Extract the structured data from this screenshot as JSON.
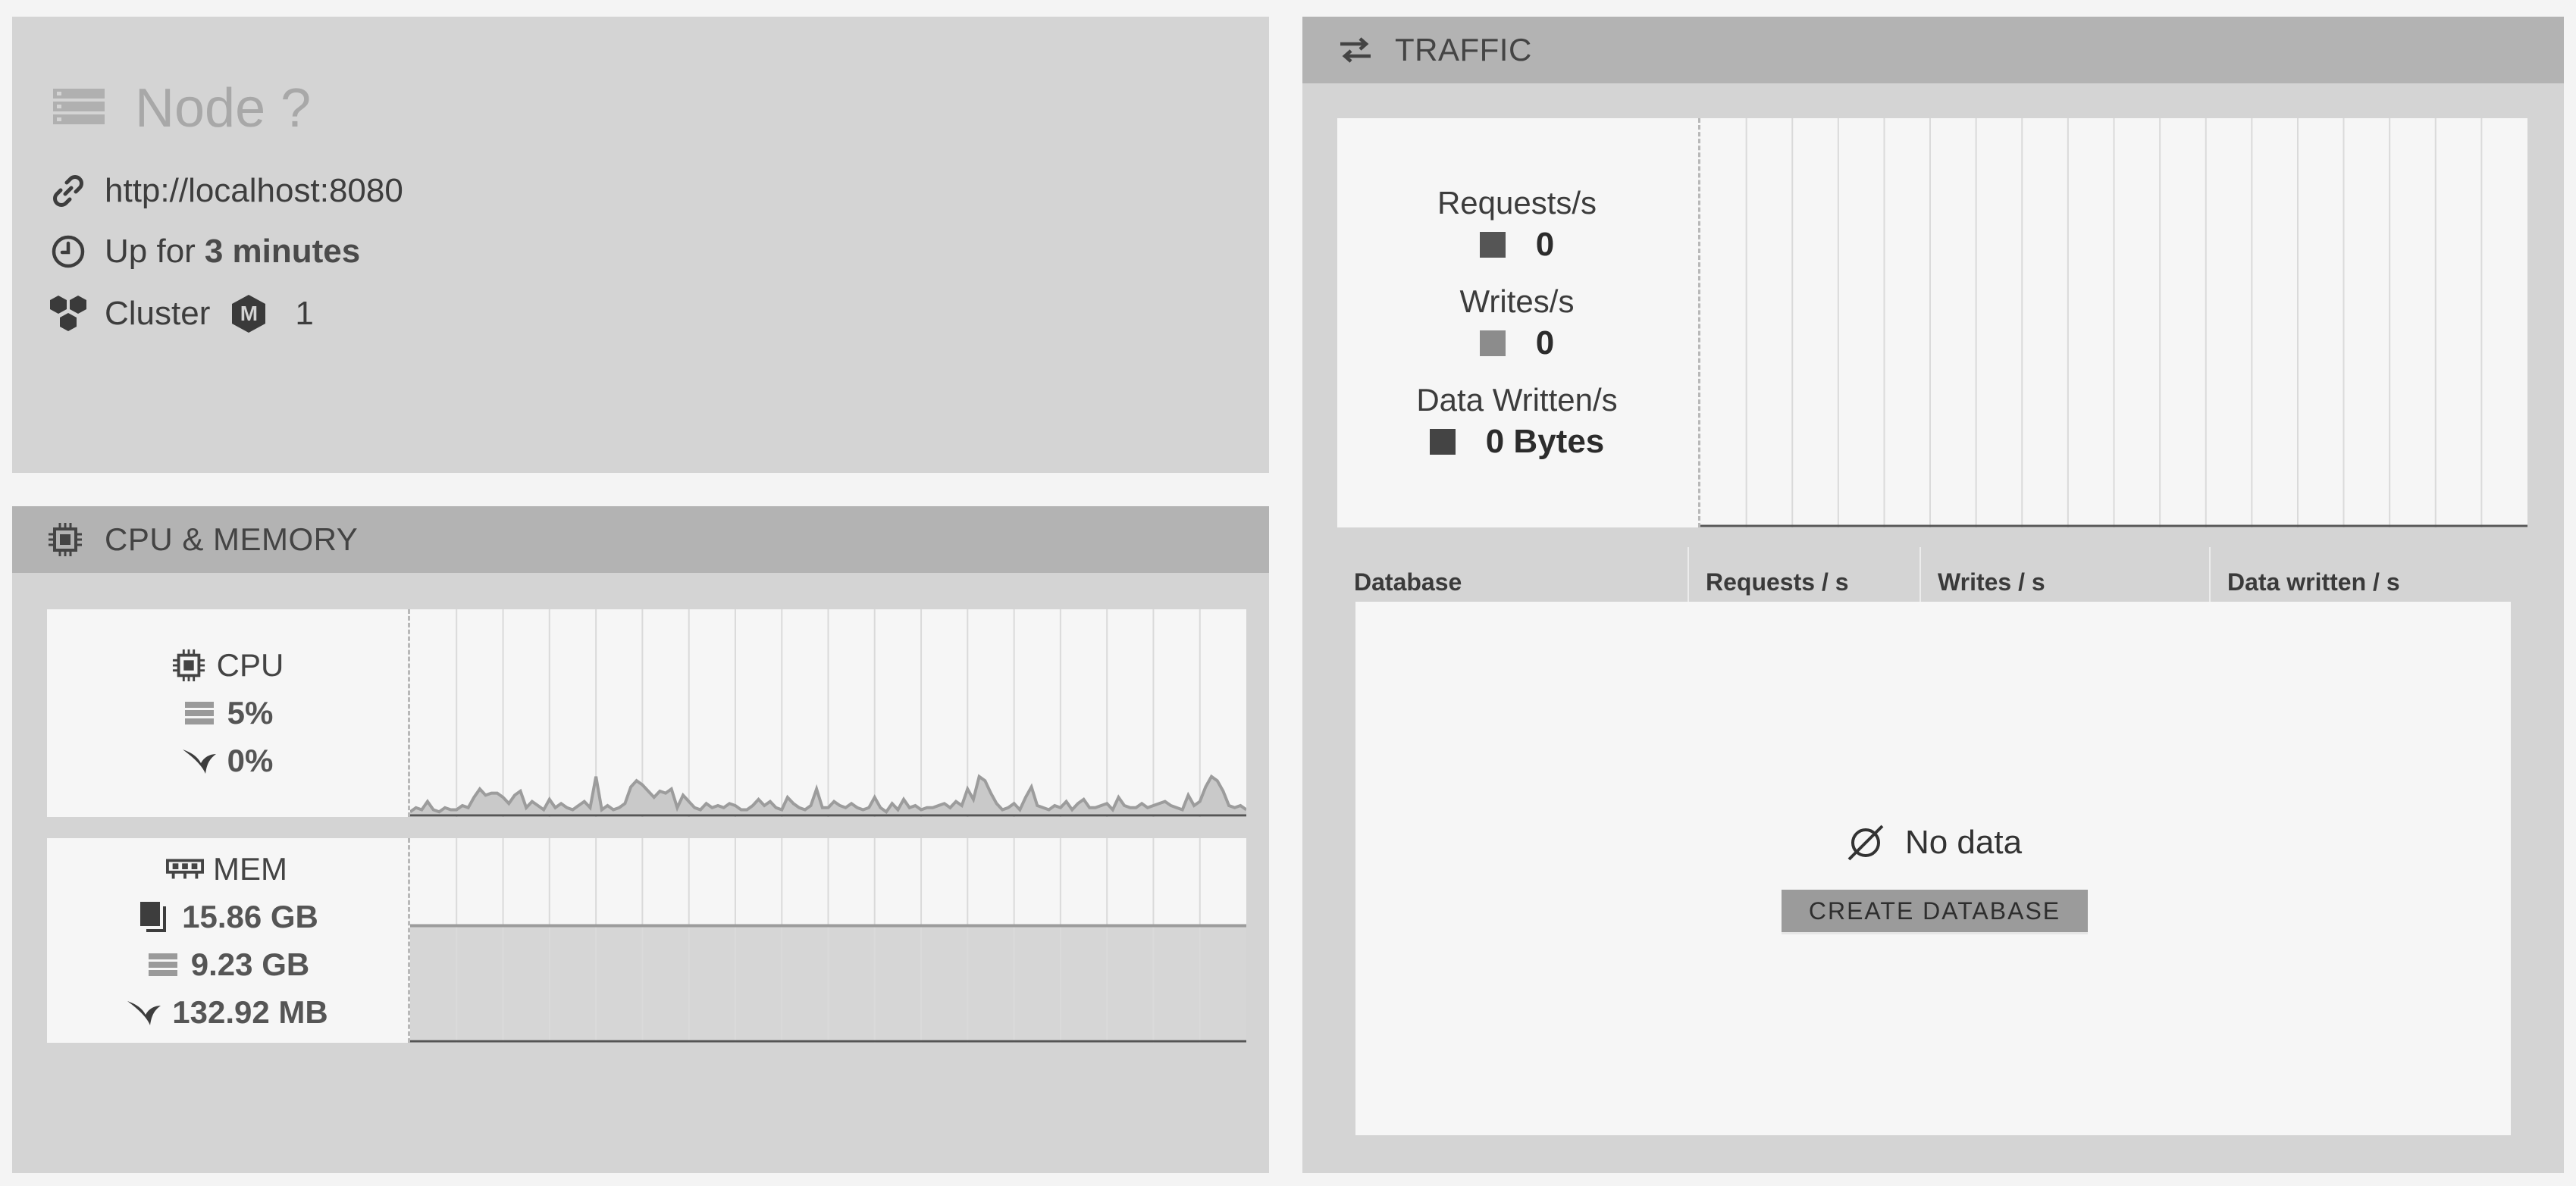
{
  "node": {
    "title": "Node ?",
    "url": "http://localhost:8080",
    "uptime_prefix": "Up for",
    "uptime_value": "3 minutes",
    "cluster_label": "Cluster",
    "cluster_badge": "M",
    "cluster_count": "1"
  },
  "cpu_memory": {
    "title": "CPU & MEMORY",
    "cpu": {
      "label": "CPU",
      "machine_value": "5%",
      "process_value": "0%"
    },
    "mem": {
      "label": "MEM",
      "total": "15.86 GB",
      "machine_used": "9.23 GB",
      "process_used": "132.92 MB"
    },
    "cpu_samples": [
      1,
      3,
      2,
      6,
      2,
      1,
      3,
      2,
      2,
      4,
      3,
      8,
      12,
      9,
      10,
      10,
      8,
      5,
      9,
      11,
      3,
      6,
      4,
      2,
      7,
      3,
      5,
      3,
      2,
      4,
      6,
      3,
      18,
      2,
      4,
      2,
      3,
      5,
      13,
      16,
      14,
      11,
      8,
      11,
      10,
      12,
      3,
      9,
      6,
      3,
      2,
      5,
      3,
      4,
      3,
      5,
      4,
      2,
      2,
      4,
      7,
      4,
      6,
      3,
      2,
      8,
      5,
      3,
      2,
      4,
      12,
      3,
      3,
      6,
      4,
      3,
      5,
      3,
      2,
      3,
      8,
      3,
      1,
      5,
      2,
      7,
      3,
      4,
      2,
      3,
      3,
      4,
      5,
      3,
      6,
      4,
      12,
      7,
      18,
      16,
      10,
      5,
      2,
      3,
      5,
      2,
      8,
      13,
      4,
      3,
      2,
      4,
      3,
      6,
      2,
      5,
      7,
      3,
      3,
      4,
      5,
      2,
      8,
      4,
      3,
      3,
      5,
      3,
      4,
      5,
      6,
      4,
      3,
      2,
      9,
      4,
      6,
      13,
      18,
      16,
      11,
      4,
      3,
      4,
      2
    ],
    "mem_level_percent": 57.2
  },
  "traffic": {
    "title": "TRAFFIC",
    "requests_label": "Requests/s",
    "requests_value": "0",
    "writes_label": "Writes/s",
    "writes_value": "0",
    "data_written_label": "Data Written/s",
    "data_written_value": "0 Bytes",
    "colors": {
      "requests": "#555555",
      "writes": "#8c8c8c",
      "data_written": "#444444"
    }
  },
  "database_table": {
    "columns": [
      "Database",
      "Requests / s",
      "Writes / s",
      "Data written / s"
    ],
    "empty_text": "No data",
    "create_button": "CREATE DATABASE"
  }
}
